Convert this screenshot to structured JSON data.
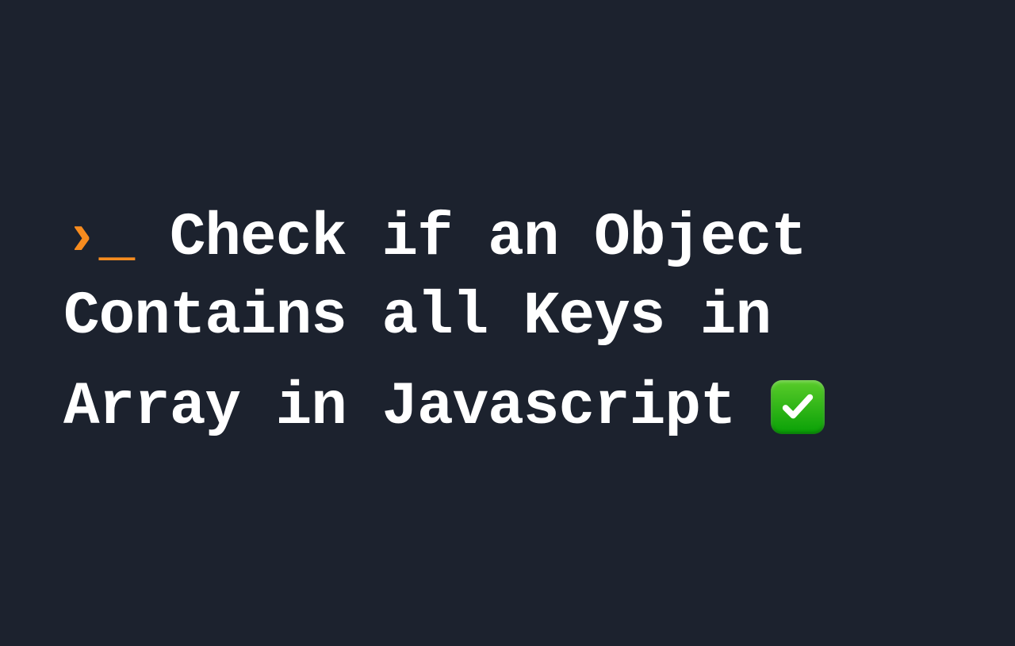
{
  "heading": {
    "prompt_caret": "›",
    "prompt_underscore": "_",
    "title": " Check if an Object Contains all Keys in Array in Javascript "
  },
  "colors": {
    "background": "#1c222e",
    "text": "#ffffff",
    "accent": "#f78c1f",
    "checkmark_bg": "#2ecc40"
  }
}
